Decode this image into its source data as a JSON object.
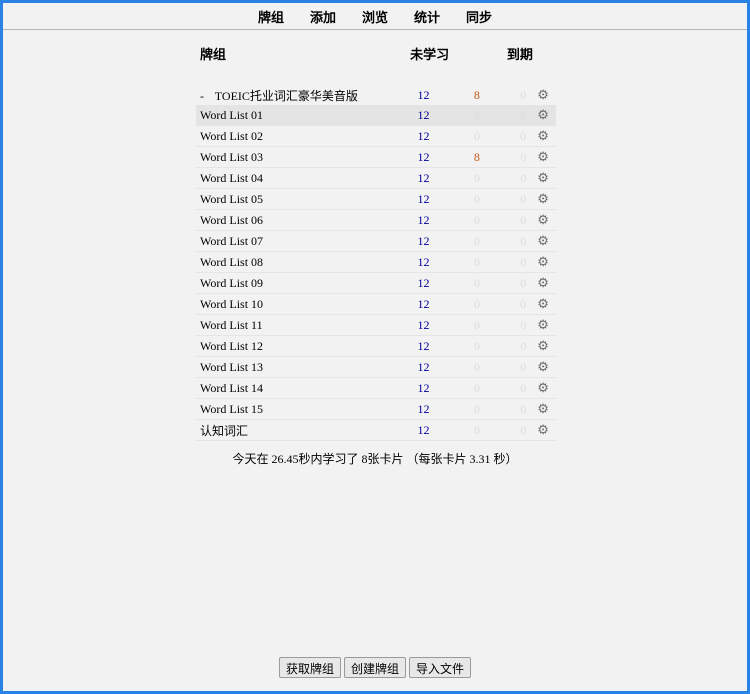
{
  "topnav": {
    "items": [
      "牌组",
      "添加",
      "浏览",
      "统计",
      "同步"
    ]
  },
  "table": {
    "headers": {
      "deck": "牌组",
      "new": "未学习",
      "due": "到期"
    },
    "parent": {
      "collapse": "-",
      "name": "TOEIC托业词汇豪华美音版",
      "new": "12",
      "learning": "8",
      "due": "0"
    },
    "rows": [
      {
        "name": "Word List 01",
        "new": "12",
        "learning": "0",
        "due": "0",
        "current": true
      },
      {
        "name": "Word List 02",
        "new": "12",
        "learning": "0",
        "due": "0"
      },
      {
        "name": "Word List 03",
        "new": "12",
        "learning": "8",
        "due": "0"
      },
      {
        "name": "Word List 04",
        "new": "12",
        "learning": "0",
        "due": "0"
      },
      {
        "name": "Word List 05",
        "new": "12",
        "learning": "0",
        "due": "0"
      },
      {
        "name": "Word List 06",
        "new": "12",
        "learning": "0",
        "due": "0"
      },
      {
        "name": "Word List 07",
        "new": "12",
        "learning": "0",
        "due": "0"
      },
      {
        "name": "Word List 08",
        "new": "12",
        "learning": "0",
        "due": "0"
      },
      {
        "name": "Word List 09",
        "new": "12",
        "learning": "0",
        "due": "0"
      },
      {
        "name": "Word List 10",
        "new": "12",
        "learning": "0",
        "due": "0"
      },
      {
        "name": "Word List 11",
        "new": "12",
        "learning": "0",
        "due": "0"
      },
      {
        "name": "Word List 12",
        "new": "12",
        "learning": "0",
        "due": "0"
      },
      {
        "name": "Word List 13",
        "new": "12",
        "learning": "0",
        "due": "0"
      },
      {
        "name": "Word List 14",
        "new": "12",
        "learning": "0",
        "due": "0"
      },
      {
        "name": "Word List 15",
        "new": "12",
        "learning": "0",
        "due": "0"
      },
      {
        "name": "认知词汇",
        "new": "12",
        "learning": "0",
        "due": "0"
      }
    ],
    "gear_glyph": "⚙"
  },
  "stats": {
    "text": "今天在 26.45秒内学习了 8张卡片 （每张卡片 3.31 秒）"
  },
  "bottom": {
    "get_shared": "获取牌组",
    "create_deck": "创建牌组",
    "import_file": "导入文件"
  },
  "colors": {
    "frame": "#2a82e4",
    "new": "#000099",
    "learning": "#c35617",
    "zero": "#dcdcdc",
    "gear": "#6d6d6d"
  }
}
